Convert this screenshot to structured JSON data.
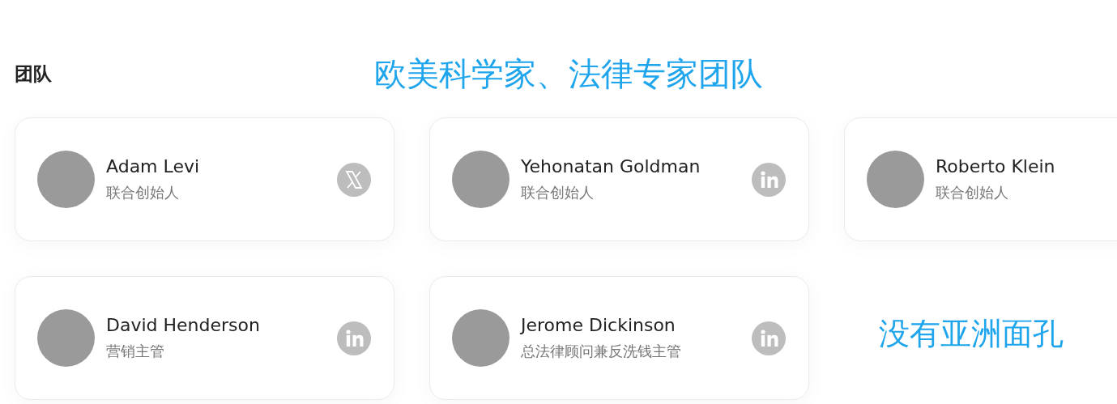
{
  "heading": "团队",
  "annotation_top": "欧美科学家、法律专家团队",
  "members": [
    {
      "name": "Adam Levi",
      "role": "联合创始人",
      "kind": "x"
    },
    {
      "name": "Yehonatan Goldman",
      "role": "联合创始人",
      "kind": "linkedin"
    },
    {
      "name": "Roberto Klein",
      "role": "联合创始人"
    },
    {
      "name": "David Henderson",
      "role": "营销主管",
      "kind": "linkedin"
    },
    {
      "name": "Jerome Dickinson",
      "role": "总法律顾问兼反洗钱主管",
      "kind": "linkedin"
    }
  ],
  "annotation_bottom": "没有亚洲面孔"
}
